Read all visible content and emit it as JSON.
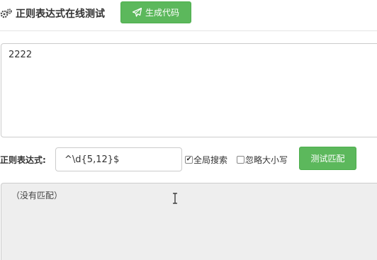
{
  "header": {
    "title": "正则表达式在线测试",
    "generate_button": "生成代码",
    "icons": [
      "gears-icon",
      "paper-plane-icon"
    ]
  },
  "editor": {
    "text_value": "2222"
  },
  "regex_row": {
    "label": "正则表达式:",
    "pattern_value": "^\\d{5,12}$",
    "global_search": {
      "label": "全局搜索",
      "checked": true
    },
    "ignore_case": {
      "label": "忽略大小写",
      "checked": false
    },
    "test_button": "测试匹配"
  },
  "result": {
    "text": "（没有匹配）"
  },
  "colors": {
    "button_green": "#5cb85c",
    "result_background": "#eeeeee"
  }
}
